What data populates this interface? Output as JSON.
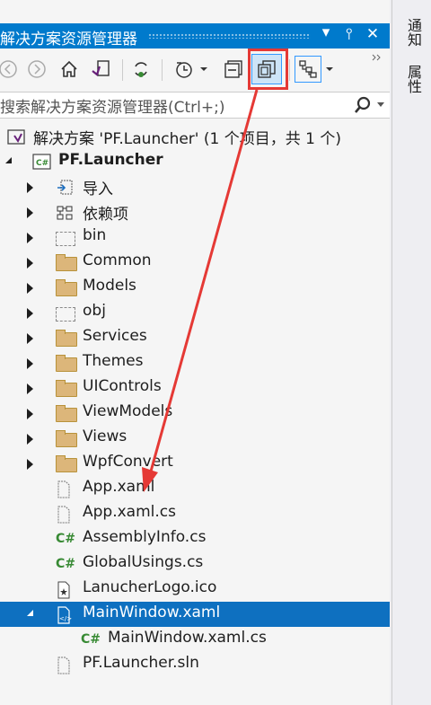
{
  "window": {
    "title": "解决方案资源管理器",
    "pin_icon": "pin-icon",
    "close_icon": "close-icon",
    "dropdown_icon": "window-menu-icon"
  },
  "search": {
    "placeholder": "搜索解决方案资源管理器(Ctrl+;)"
  },
  "side_tabs": [
    "通知",
    "属性"
  ],
  "tree": {
    "solution_label": "解决方案 'PF.Launcher' (1 个项目，共 1 个)",
    "project_label": "PF.Launcher",
    "items": [
      {
        "label": "导入",
        "icon": "import-icon",
        "expander": "closed"
      },
      {
        "label": "依赖项",
        "icon": "dependencies-icon",
        "expander": "closed"
      },
      {
        "label": "bin",
        "icon": "hidden-folder-icon",
        "expander": "closed"
      },
      {
        "label": "Common",
        "icon": "folder-icon",
        "expander": "closed"
      },
      {
        "label": "Models",
        "icon": "folder-icon",
        "expander": "closed"
      },
      {
        "label": "obj",
        "icon": "hidden-folder-icon",
        "expander": "closed"
      },
      {
        "label": "Services",
        "icon": "folder-icon",
        "expander": "closed"
      },
      {
        "label": "Themes",
        "icon": "folder-icon",
        "expander": "closed"
      },
      {
        "label": "UIControls",
        "icon": "folder-icon",
        "expander": "closed"
      },
      {
        "label": "ViewModels",
        "icon": "folder-icon",
        "expander": "closed"
      },
      {
        "label": "Views",
        "icon": "folder-icon",
        "expander": "closed"
      },
      {
        "label": "WpfConvert",
        "icon": "folder-icon",
        "expander": "closed"
      },
      {
        "label": "App.xaml",
        "icon": "file-icon",
        "expander": "none"
      },
      {
        "label": "App.xaml.cs",
        "icon": "file-icon",
        "expander": "none"
      },
      {
        "label": "AssemblyInfo.cs",
        "icon": "csharp-icon",
        "expander": "none"
      },
      {
        "label": "GlobalUsings.cs",
        "icon": "csharp-icon",
        "expander": "none"
      },
      {
        "label": "LanucherLogo.ico",
        "icon": "ico-file-icon",
        "expander": "none"
      },
      {
        "label": "MainWindow.xaml",
        "icon": "xaml-window-icon",
        "expander": "open",
        "selected": true
      },
      {
        "label": "MainWindow.xaml.cs",
        "icon": "csharp-icon",
        "expander": "none",
        "child": true
      },
      {
        "label": "PF.Launcher.sln",
        "icon": "file-icon",
        "expander": "none"
      }
    ]
  },
  "colors": {
    "accent": "#007acc",
    "selection": "#0e70c0",
    "highlight_box": "#e53935",
    "annotation_arrow": "#e53935"
  }
}
